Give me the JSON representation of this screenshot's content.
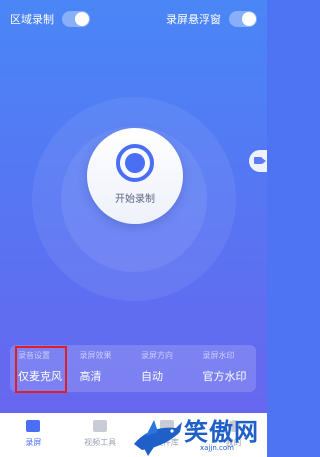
{
  "header": {
    "region_record_label": "区域录制",
    "floating_window_label": "录屏悬浮窗"
  },
  "record_button": {
    "label": "开始录制"
  },
  "settings": [
    {
      "title": "录音设置",
      "value": "仅麦克风"
    },
    {
      "title": "录屏效果",
      "value": "高清"
    },
    {
      "title": "录屏方向",
      "value": "自动"
    },
    {
      "title": "录屏水印",
      "value": "官方水印"
    }
  ],
  "tabs": [
    {
      "label": "录屏",
      "icon": "video-camera-icon",
      "active": true
    },
    {
      "label": "视频工具",
      "icon": "toolbox-icon",
      "active": false
    },
    {
      "label": "文件库",
      "icon": "folder-icon",
      "active": false
    },
    {
      "label": "我的",
      "icon": "user-icon",
      "active": false
    }
  ],
  "watermark": {
    "brand": "笑傲网",
    "url": "xajjn.com"
  },
  "colors": {
    "accent": "#4b6ff4",
    "highlight_border": "#e01e24",
    "watermark": "#1f5fc8"
  }
}
